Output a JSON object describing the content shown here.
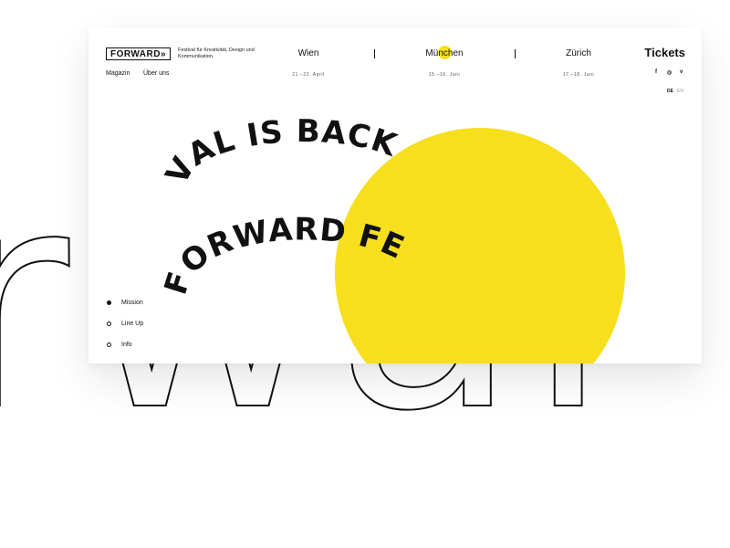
{
  "background_word": "rwar",
  "header": {
    "logo": "FORWARD»",
    "tagline": "Festival für Kreativität, Design und Kommunikation.",
    "tickets_label": "Tickets"
  },
  "cities": [
    {
      "name": "Wien",
      "date": "21.–22. April"
    },
    {
      "name": "München",
      "date": "15.–16. Juni"
    },
    {
      "name": "Zürich",
      "date": "17.–18. Juni"
    }
  ],
  "sub_nav": {
    "magazin": "Magazin",
    "ueber_uns": "Über uns"
  },
  "social": {
    "facebook": "f",
    "instagram": "◎",
    "vimeo": "v"
  },
  "languages": {
    "de": "DE",
    "en": "EN"
  },
  "hero": {
    "ring_text_front": "FORWARD FE",
    "ring_text_back": "VAL IS BACK"
  },
  "side_nav": [
    "Mission",
    "Line Up",
    "Info"
  ],
  "colors": {
    "accent": "#f7df1e",
    "text": "#111111",
    "background": "#ffffff"
  }
}
